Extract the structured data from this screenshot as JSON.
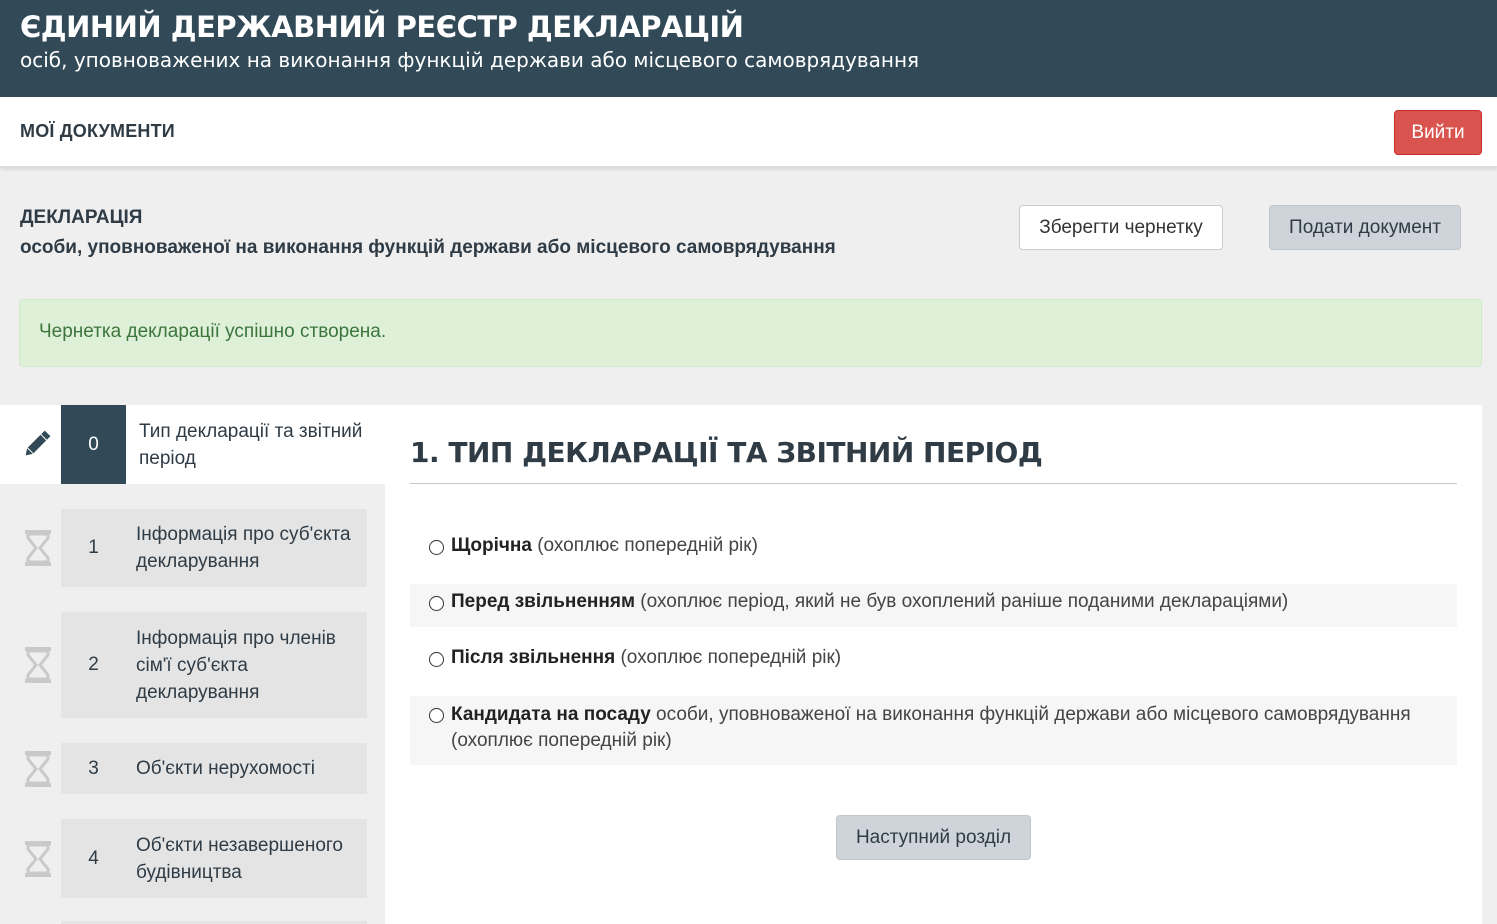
{
  "banner": {
    "title": "ЄДИНИЙ ДЕРЖАВНИЙ РЕЄСТР ДЕКЛАРАЦІЙ",
    "subtitle": "осіб, уповноважених на виконання функцій держави або місцевого самоврядування"
  },
  "nav": {
    "my_documents": "МОЇ ДОКУМЕНТИ",
    "logout": "Вийти"
  },
  "declaration": {
    "title": "ДЕКЛАРАЦІЯ",
    "subtitle": "особи, уповноваженої на виконання функцій держави або місцевого самоврядування",
    "save_draft": "Зберегти чернетку",
    "submit": "Подати документ"
  },
  "alert": {
    "message": "Чернетка декларації успішно створена."
  },
  "steps": [
    {
      "num": "0",
      "label": "Тип декларації та звітний період",
      "icon": "pencil-icon",
      "active": true
    },
    {
      "num": "1",
      "label": "Інформація про суб'єкта декларування",
      "icon": "hourglass-icon"
    },
    {
      "num": "2",
      "label": "Інформація про членів сім'ї суб'єкта декларування",
      "icon": "hourglass-icon"
    },
    {
      "num": "3",
      "label": "Об'єкти нерухомості",
      "icon": "hourglass-icon"
    },
    {
      "num": "4",
      "label": "Об'єкти незавершеного будівництва",
      "icon": "hourglass-icon"
    }
  ],
  "section": {
    "number": "1.",
    "title": "ТИП ДЕКЛАРАЦІЇ ТА ЗВІТНИЙ ПЕРІОД",
    "options": [
      {
        "bold": "Щорічна",
        "rest": " (охоплює попередній рік)"
      },
      {
        "bold": "Перед звільненням",
        "rest": " (охоплює період, який не був охоплений раніше поданими деклараціями)"
      },
      {
        "bold": "Після звільнення",
        "rest": " (охоплює попередній рік)"
      },
      {
        "bold": "Кандидата на посаду",
        "rest": " особи, уповноваженої на виконання функцій держави або місцевого самоврядування (охоплює попередній рік)"
      }
    ],
    "next_button": "Наступний розділ"
  },
  "colors": {
    "banner": "#324a58",
    "logout": "#d9534f",
    "alert_bg": "#dff0d8",
    "alert_text": "#3c763d",
    "active_step": "#324a58"
  }
}
